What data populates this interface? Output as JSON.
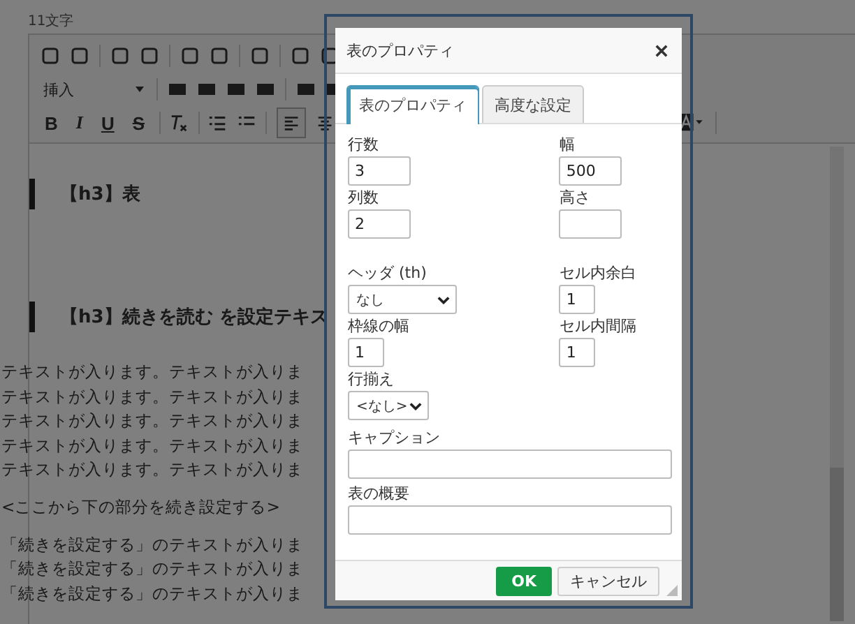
{
  "counter": "11文字",
  "toolbar": {
    "insert_label": "挿入",
    "format_letters": [
      "B",
      "I",
      "U",
      "S"
    ]
  },
  "editor": {
    "headings": [
      "【h3】表",
      "【h3】続きを読む を設定テキス"
    ],
    "paragraph_lines": [
      "テキストが入ります。テキストが入りま",
      "テキストが入ります。テキストが入りま",
      "テキストが入ります。テキストが入りま",
      "テキストが入ります。テキストが入りま",
      "テキストが入ります。テキストが入りま"
    ],
    "note": "<ここから下の部分を続き設定する>",
    "more_lines": [
      "「続きを設定する」のテキストが入りま",
      "「続きを設定する」のテキストが入りま",
      "「続きを設定する」のテキストが入りま"
    ]
  },
  "dialog": {
    "title": "表のプロパティ",
    "tabs": [
      {
        "label": "表のプロパティ",
        "selected": true
      },
      {
        "label": "高度な設定",
        "selected": false
      }
    ],
    "left_fields": [
      {
        "label": "行数",
        "value": "3",
        "kind": "text"
      },
      {
        "label": "列数",
        "value": "2",
        "kind": "text"
      },
      {
        "label": "ヘッダ (th)",
        "value": "なし",
        "kind": "select"
      },
      {
        "label": "枠線の幅",
        "value": "1",
        "kind": "small"
      },
      {
        "label": "行揃え",
        "value": "<なし>",
        "kind": "select-small"
      }
    ],
    "right_fields": [
      {
        "label": "幅",
        "value": "500",
        "kind": "text"
      },
      {
        "label": "高さ",
        "kind": "text"
      },
      {
        "label": "セル内余白",
        "value": "1",
        "kind": "small"
      },
      {
        "label": "セル内間隔",
        "value": "1",
        "kind": "small"
      }
    ],
    "wide_fields": [
      {
        "label": "キャプション"
      },
      {
        "label": "表の概要"
      }
    ],
    "buttons": [
      {
        "label": "OK",
        "kind": "primary"
      },
      {
        "label": "キャンセル",
        "kind": "secondary"
      }
    ]
  }
}
